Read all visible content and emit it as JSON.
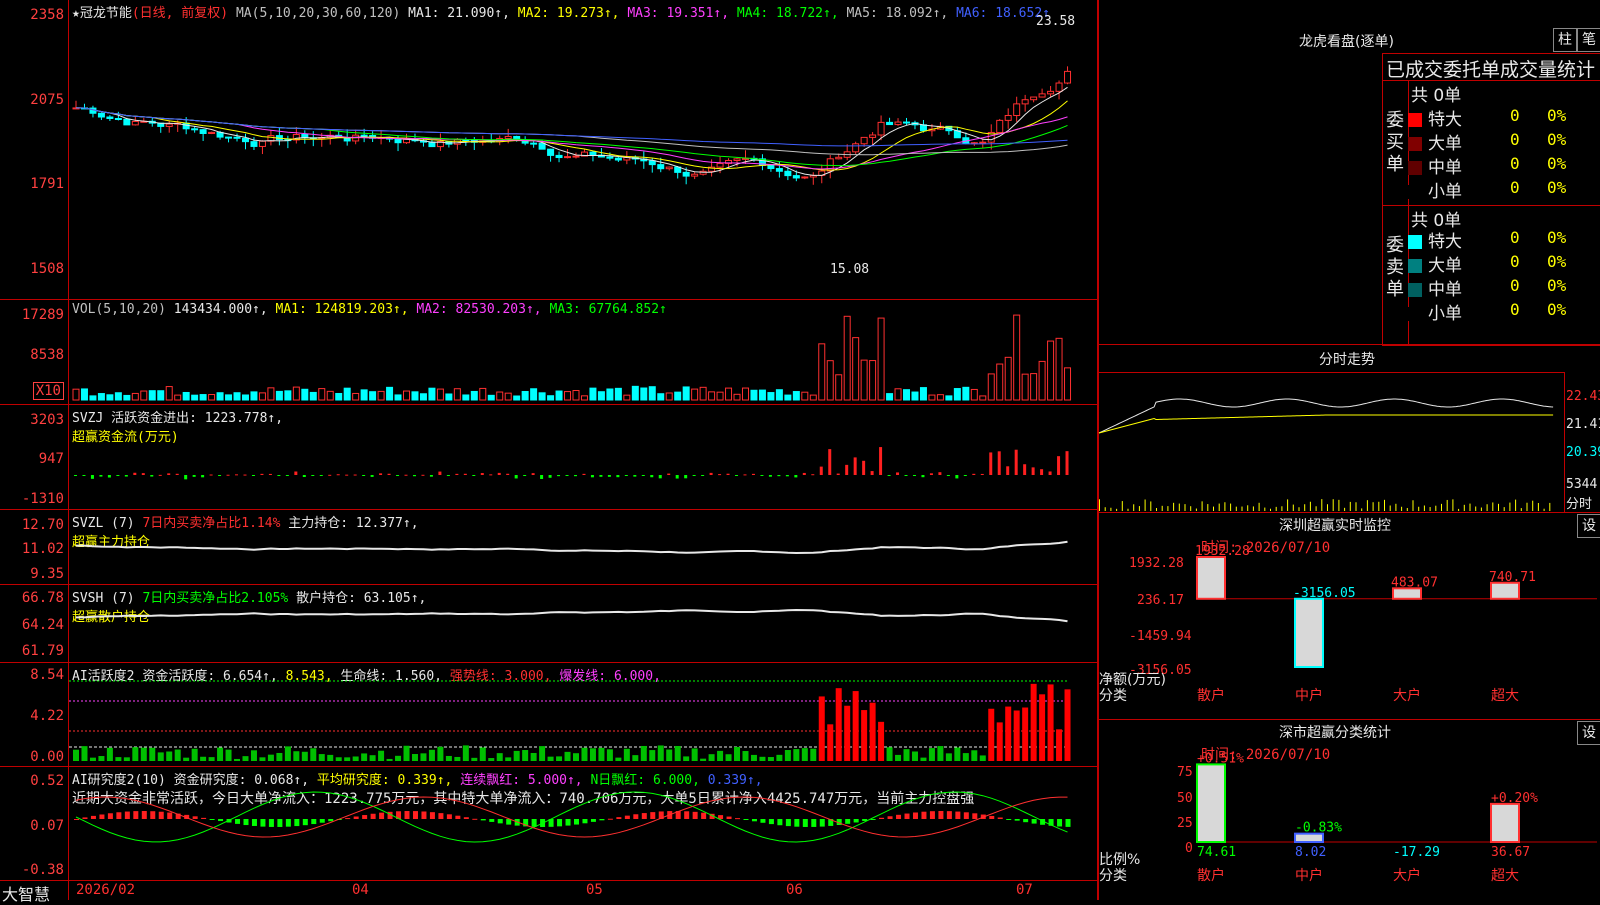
{
  "stock": {
    "name": "★冠龙节能",
    "period": "(日线, 前复权)"
  },
  "price_panel": {
    "y_labels": [
      "2358",
      "2075",
      "1791",
      "1508"
    ],
    "ma_text": "MA(5,10,20,30,60,120)",
    "ma": [
      {
        "label": "MA1: 21.090↑,",
        "color": "#e8e8e8"
      },
      {
        "label": "MA2: 19.273↑,",
        "color": "#ffff00"
      },
      {
        "label": "MA3: 19.351↑,",
        "color": "#ff40ff"
      },
      {
        "label": "MA4: 18.722↑,",
        "color": "#00ff00"
      },
      {
        "label": "MA5: 18.092↑,",
        "color": "#c0c0c0"
      },
      {
        "label": "MA6: 18.652↑",
        "color": "#4060ff"
      }
    ],
    "high_label": "23.58",
    "low_label": "15.08"
  },
  "vol_panel": {
    "y_labels": [
      "17289",
      "8538"
    ],
    "unit": "X10",
    "header": [
      {
        "label": "VOL(5,10,20)",
        "color": "#c0c0c0"
      },
      {
        "label": "143434.000↑,",
        "color": "#e8e8e8"
      },
      {
        "label": "MA1: 124819.203↑,",
        "color": "#ffff00"
      },
      {
        "label": "MA2: 82530.203↑,",
        "color": "#ff40ff"
      },
      {
        "label": "MA3: 67764.852↑",
        "color": "#00ff00"
      }
    ]
  },
  "svzj_panel": {
    "y_labels": [
      "3203",
      "947",
      "-1310"
    ],
    "header": "SVZJ  活跃资金进出: 1223.778↑,",
    "subtitle": "超赢资金流(万元)"
  },
  "svzl_panel": {
    "y_labels": [
      "12.70",
      "11.02",
      "9.35"
    ],
    "header_a": "SVZL (7)",
    "header_b": "7日内买卖净占比1.14%",
    "header_c": "主力持仓: 12.377↑,",
    "subtitle": "超赢主力持仓"
  },
  "svsh_panel": {
    "y_labels": [
      "66.78",
      "64.24",
      "61.79"
    ],
    "header_a": "SVSH (7)",
    "header_b": "7日内买卖净占比2.105%",
    "header_c": "散户持仓: 63.105↑,",
    "subtitle": "超赢散户持仓"
  },
  "ai_active_panel": {
    "y_labels": [
      "8.54",
      "4.22",
      "0.00"
    ],
    "header": [
      {
        "label": "AI活跃度2",
        "color": "#e8e8e8"
      },
      {
        "label": "资金活跃度: 6.654↑,",
        "color": "#e8e8e8"
      },
      {
        "label": "8.543,",
        "color": "#ffff00"
      },
      {
        "label": "生命线: 1.560,",
        "color": "#e8e8e8"
      },
      {
        "label": "强势线: 3.000,",
        "color": "#ff3030"
      },
      {
        "label": "爆发线: 6.000,",
        "color": "#ff40ff"
      }
    ]
  },
  "ai_research_panel": {
    "y_labels": [
      "0.52",
      "0.07",
      "-0.38"
    ],
    "header": [
      {
        "label": "AI研究度2(10)",
        "color": "#e8e8e8"
      },
      {
        "label": "资金研究度: 0.068↑,",
        "color": "#e8e8e8"
      },
      {
        "label": "平均研究度: 0.339↑,",
        "color": "#ffff00"
      },
      {
        "label": "连续飘红: 5.000↑,",
        "color": "#ff40ff"
      },
      {
        "label": "N日飘红: 6.000,",
        "color": "#00ff00"
      },
      {
        "label": "0.339↑,",
        "color": "#4060ff"
      }
    ],
    "note": "近期大资金非常活跃，今日大单净流入：1223.775万元，其中特大单净流入：740.706万元，大单5日累计净入4425.747万元，当前主力控盘强"
  },
  "x_axis": {
    "brand": "大智慧",
    "labels": [
      "2026/02",
      "04",
      "05",
      "06",
      "07"
    ]
  },
  "dragon_tiger": {
    "title": "龙虎看盘(逐单)",
    "btn_bar": "柱",
    "btn_order": "笔",
    "subtitle": "已成交委托单成交量统计",
    "buy_label": "委买单",
    "sell_label": "委卖单",
    "buy_total": "共 0单",
    "sell_total": "共 0单",
    "buy_rows": [
      {
        "label": "特大",
        "value": "0",
        "pct": "0%",
        "color": "#ff0000"
      },
      {
        "label": "大单",
        "value": "0",
        "pct": "0%",
        "color": "#800000"
      },
      {
        "label": "中单",
        "value": "0",
        "pct": "0%",
        "color": "#600000"
      },
      {
        "label": "小单",
        "value": "0",
        "pct": "0%",
        "color": "#000000"
      }
    ],
    "sell_rows": [
      {
        "label": "特大",
        "value": "0",
        "pct": "0%",
        "color": "#00ffff"
      },
      {
        "label": "大单",
        "value": "0",
        "pct": "0%",
        "color": "#008080"
      },
      {
        "label": "中单",
        "value": "0",
        "pct": "0%",
        "color": "#006060"
      },
      {
        "label": "小单",
        "value": "0",
        "pct": "0%",
        "color": "#000000"
      }
    ]
  },
  "intraday": {
    "title": "分时走势",
    "y_labels": [
      "22.43",
      "21.41",
      "20.39"
    ],
    "vol_label": "5344",
    "vol_unit": "分时"
  },
  "sz_monitor": {
    "title": "深圳超赢实时监控",
    "btn": "设",
    "time": "时间: 2026/07/10",
    "y_labels": [
      "1932.28",
      "236.17",
      "-1459.94",
      "-3156.05"
    ],
    "unit_label": "净额(万元)",
    "cat_label": "分类",
    "categories": [
      "散户",
      "中户",
      "大户",
      "超大"
    ],
    "values": [
      "1932.28",
      "-3156.05",
      "483.07",
      "740.71"
    ]
  },
  "sz_classify": {
    "title": "深市超赢分类统计",
    "btn": "设",
    "time": "时间: 2026/07/10",
    "y_labels": [
      "75",
      "50",
      "25",
      "0"
    ],
    "unit_label": "比例%",
    "cat_label": "分类",
    "categories": [
      "散户",
      "中户",
      "大户",
      "超大"
    ],
    "top_labels": [
      "+0.51%",
      "-0.83%",
      "",
      "+0.20%"
    ],
    "bottom_values": [
      "74.61",
      "8.02",
      "-17.29",
      "36.67"
    ]
  },
  "chart_data": [
    {
      "type": "candlestick",
      "title": "冠龙节能 日线",
      "x": [
        "2026/02",
        "04",
        "05",
        "06",
        "07"
      ],
      "ylim": [
        15.08,
        23.58
      ],
      "series": [
        {
          "name": "MA1",
          "values": [
            21.09
          ]
        },
        {
          "name": "MA2",
          "values": [
            19.273
          ]
        },
        {
          "name": "MA3",
          "values": [
            19.351
          ]
        },
        {
          "name": "MA4",
          "values": [
            18.722
          ]
        },
        {
          "name": "MA5",
          "values": [
            18.092
          ]
        },
        {
          "name": "MA6",
          "values": [
            18.652
          ]
        }
      ]
    },
    {
      "type": "bar",
      "title": "深圳超赢实时监控",
      "categories": [
        "散户",
        "中户",
        "大户",
        "超大"
      ],
      "values": [
        1932.28,
        -3156.05,
        483.07,
        740.71
      ],
      "ylabel": "净额(万元)",
      "ylim": [
        -3156.05,
        1932.28
      ]
    },
    {
      "type": "bar",
      "title": "深市超赢分类统计",
      "categories": [
        "散户",
        "中户",
        "大户",
        "超大"
      ],
      "values": [
        74.61,
        8.02,
        -17.29,
        36.67
      ],
      "ylabel": "比例%",
      "ylim": [
        0,
        75
      ]
    }
  ]
}
